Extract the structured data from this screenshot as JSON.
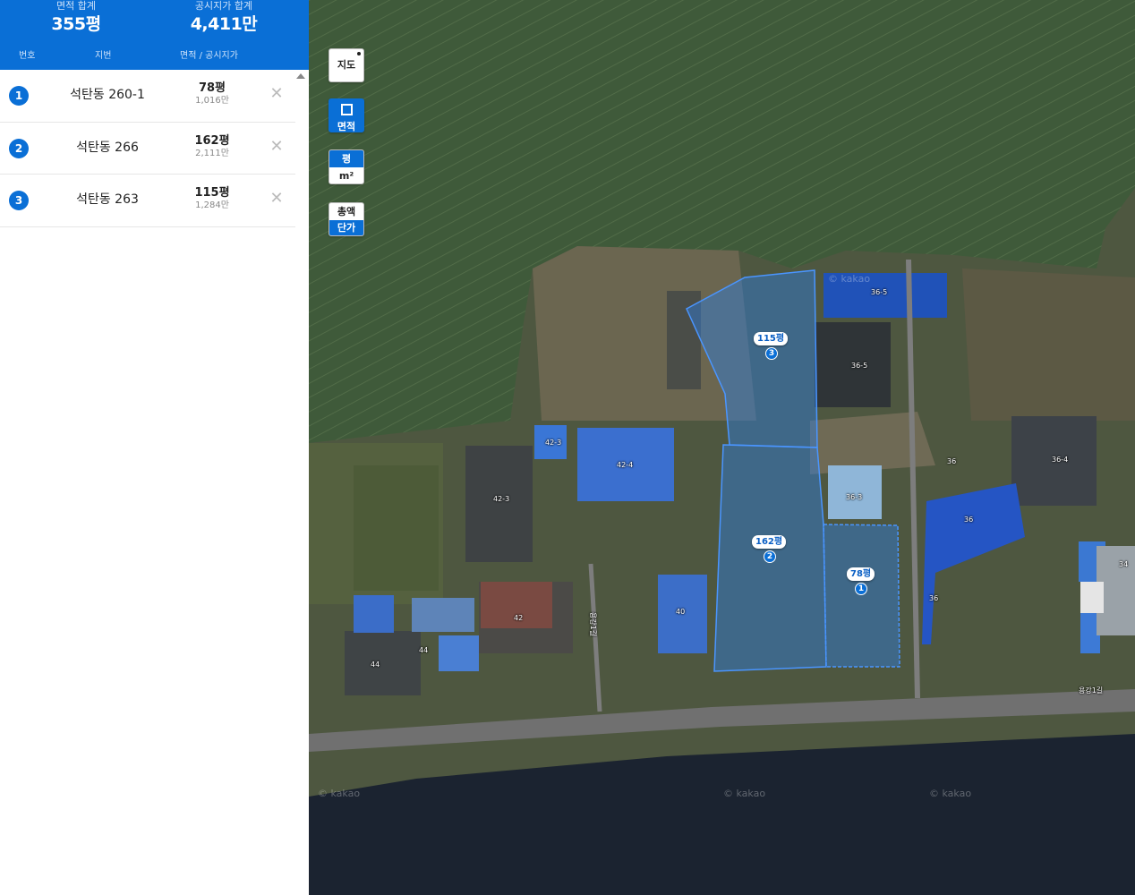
{
  "summary": {
    "area_label": "면적 합계",
    "area_value": "355평",
    "price_label": "공시지가 합계",
    "price_value": "4,411만"
  },
  "columns": {
    "number": "번호",
    "jibun": "지번",
    "area_price": "면적 / 공시지가"
  },
  "parcels": [
    {
      "number": "1",
      "jibun": "석탄동 260-1",
      "area": "78평",
      "price": "1,016만"
    },
    {
      "number": "2",
      "jibun": "석탄동 266",
      "area": "162평",
      "price": "2,111만"
    },
    {
      "number": "3",
      "jibun": "석탄동 263",
      "area": "115평",
      "price": "1,284만"
    }
  ],
  "remove_glyph": "✕",
  "controls": {
    "map_type": "지도",
    "area_tool": "면적",
    "unit_pyeong": "평",
    "unit_m2": "m²",
    "total": "총액",
    "unit_price": "단가"
  },
  "map_pins": [
    {
      "area": "115평",
      "number": "3"
    },
    {
      "area": "162평",
      "number": "2"
    },
    {
      "area": "78평",
      "number": "1"
    }
  ],
  "map_labels": [
    "36-5",
    "36-5",
    "42-3",
    "42-4",
    "42-3",
    "36-3",
    "36",
    "36-4",
    "36",
    "34",
    "36",
    "42",
    "40",
    "44",
    "44",
    "용강1길",
    "용강1길"
  ],
  "watermark": "© kakao",
  "colors": {
    "accent": "#0a6fd6",
    "parcel_fill": "#2f7fe0"
  }
}
